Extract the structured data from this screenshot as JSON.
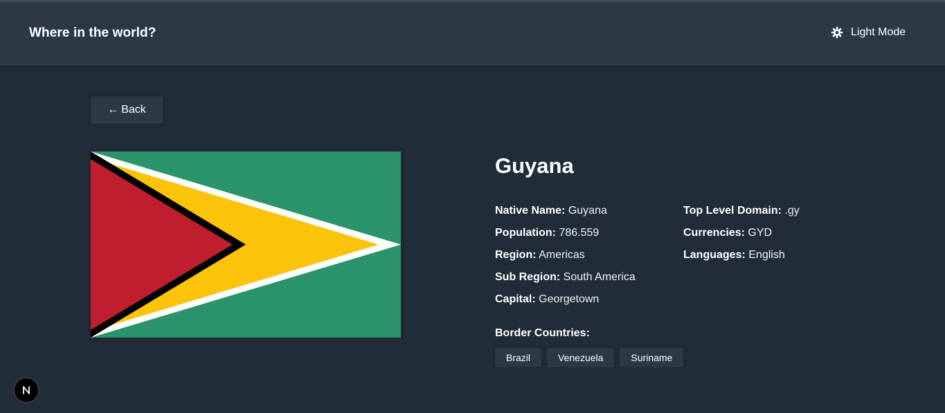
{
  "header": {
    "title": "Where in the world?",
    "theme_toggle_label": "Light Mode",
    "theme_icon": "gear-sun-icon"
  },
  "back_button": {
    "arrow": "←",
    "label": "Back"
  },
  "country": {
    "flag": {
      "alt": "Guyana flag",
      "colors": {
        "green": "#2b936a",
        "white": "#ffffff",
        "yellow": "#fcc30b",
        "black": "#000000",
        "red": "#be1e2d"
      }
    },
    "name": "Guyana",
    "details_left": [
      {
        "label": "Native Name:",
        "value": "Guyana"
      },
      {
        "label": "Population:",
        "value": "786.559"
      },
      {
        "label": "Region:",
        "value": "Americas"
      },
      {
        "label": "Sub Region:",
        "value": "South America"
      },
      {
        "label": "Capital:",
        "value": "Georgetown"
      }
    ],
    "details_right": [
      {
        "label": "Top Level Domain:",
        "value": ".gy"
      },
      {
        "label": "Currencies:",
        "value": "GYD"
      },
      {
        "label": "Languages:",
        "value": "English"
      }
    ],
    "border_label": "Border Countries:",
    "borders": [
      "Brazil",
      "Venezuela",
      "Suriname"
    ]
  },
  "dev_badge": {
    "letter": "N",
    "icon": "nextjs-icon"
  },
  "colors": {
    "background": "#202c37",
    "elements": "#2b3945",
    "text": "#ffffff"
  }
}
